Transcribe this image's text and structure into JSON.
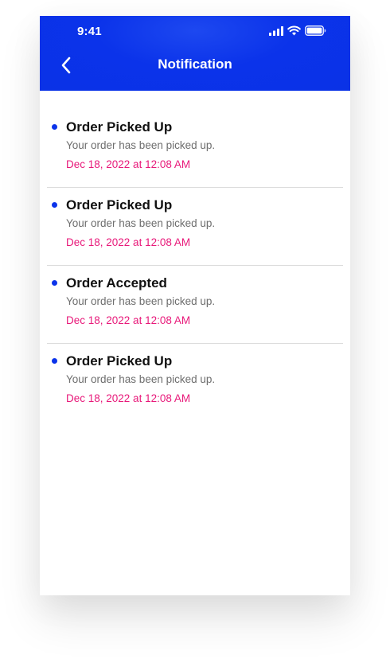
{
  "status_bar": {
    "time": "9:41",
    "icons": [
      "cellular-signal-icon",
      "wifi-icon",
      "battery-icon"
    ]
  },
  "header": {
    "title": "Notification",
    "back_icon": "chevron-left-icon"
  },
  "colors": {
    "header_blue": "#0b33ea",
    "timestamp_pink": "#e8197a",
    "unread_dot": "#0b33ea"
  },
  "notifications": [
    {
      "title": "Order Picked Up",
      "message": "Your order has been picked up.",
      "timestamp": "Dec 18, 2022 at 12:08 AM"
    },
    {
      "title": "Order Picked Up",
      "message": "Your order has been picked up.",
      "timestamp": "Dec 18, 2022 at 12:08 AM"
    },
    {
      "title": "Order Accepted",
      "message": "Your order has been picked up.",
      "timestamp": "Dec 18, 2022 at 12:08 AM"
    },
    {
      "title": "Order Picked Up",
      "message": "Your order has been picked up.",
      "timestamp": "Dec 18, 2022 at 12:08 AM"
    }
  ]
}
